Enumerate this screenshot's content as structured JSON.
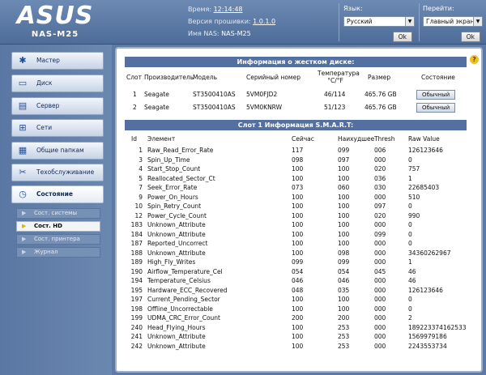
{
  "header": {
    "brand": "ASUS",
    "model": "NAS-M25",
    "time_label": "Время:",
    "time_value": "12:14:48",
    "firmware_label": "Версия прошивки:",
    "firmware_value": "1.0.1.0",
    "nas_name_label": "Имя NAS:",
    "nas_name_value": "NAS-M25",
    "language_label": "Язык:",
    "language_value": "Русский",
    "language_ok": "Ok",
    "goto_label": "Перейти:",
    "goto_value": "Главный экран",
    "goto_ok": "Ok"
  },
  "sidebar": {
    "items": [
      {
        "label": "Мастер",
        "icon": "wizard-icon"
      },
      {
        "label": "Диск",
        "icon": "disk-icon"
      },
      {
        "label": "Сервер",
        "icon": "server-icon"
      },
      {
        "label": "Сети",
        "icon": "network-icon"
      },
      {
        "label": "Общие папкам",
        "icon": "shared-folder-icon"
      },
      {
        "label": "Техобслуживание",
        "icon": "maintenance-icon"
      },
      {
        "label": "Состояние",
        "icon": "status-icon"
      }
    ],
    "subitems": [
      {
        "label": "Сост. системы"
      },
      {
        "label": "Сост. HD"
      },
      {
        "label": "Сост. принтера"
      },
      {
        "label": "Журнал"
      }
    ]
  },
  "disk_info": {
    "title": "Информация о жестком диске:",
    "columns": {
      "slot": "Слот",
      "vendor": "Производитель",
      "model": "Модель",
      "serial": "Серийный номер",
      "temp": "Температура °C/°F",
      "size": "Размер",
      "status": "Состояние"
    },
    "rows": [
      {
        "slot": "1",
        "vendor": "Seagate",
        "model": "ST3500410AS",
        "serial": "5VM0FJD2",
        "temp": "46/114",
        "size": "465.76 GB",
        "status": "Обычный"
      },
      {
        "slot": "2",
        "vendor": "Seagate",
        "model": "ST3500410AS",
        "serial": "5VM0KNRW",
        "temp": "51/123",
        "size": "465.76 GB",
        "status": "Обычный"
      }
    ]
  },
  "smart": {
    "title": "Слот 1 Информация S.M.A.R.T:",
    "columns": {
      "id": "Id",
      "element": "Элемент",
      "now": "Сейчас",
      "worst": "Наихудшее",
      "thresh": "Thresh",
      "raw": "Raw Value"
    },
    "rows": [
      {
        "id": "1",
        "element": "Raw_Read_Error_Rate",
        "now": "117",
        "worst": "099",
        "thresh": "006",
        "raw": "126123646"
      },
      {
        "id": "3",
        "element": "Spin_Up_Time",
        "now": "098",
        "worst": "097",
        "thresh": "000",
        "raw": "0"
      },
      {
        "id": "4",
        "element": "Start_Stop_Count",
        "now": "100",
        "worst": "100",
        "thresh": "020",
        "raw": "757"
      },
      {
        "id": "5",
        "element": "Reallocated_Sector_Ct",
        "now": "100",
        "worst": "100",
        "thresh": "036",
        "raw": "1"
      },
      {
        "id": "7",
        "element": "Seek_Error_Rate",
        "now": "073",
        "worst": "060",
        "thresh": "030",
        "raw": "22685403"
      },
      {
        "id": "9",
        "element": "Power_On_Hours",
        "now": "100",
        "worst": "100",
        "thresh": "000",
        "raw": "510"
      },
      {
        "id": "10",
        "element": "Spin_Retry_Count",
        "now": "100",
        "worst": "100",
        "thresh": "097",
        "raw": "0"
      },
      {
        "id": "12",
        "element": "Power_Cycle_Count",
        "now": "100",
        "worst": "100",
        "thresh": "020",
        "raw": "990"
      },
      {
        "id": "183",
        "element": "Unknown_Attribute",
        "now": "100",
        "worst": "100",
        "thresh": "000",
        "raw": "0"
      },
      {
        "id": "184",
        "element": "Unknown_Attribute",
        "now": "100",
        "worst": "100",
        "thresh": "099",
        "raw": "0"
      },
      {
        "id": "187",
        "element": "Reported_Uncorrect",
        "now": "100",
        "worst": "100",
        "thresh": "000",
        "raw": "0"
      },
      {
        "id": "188",
        "element": "Unknown_Attribute",
        "now": "100",
        "worst": "098",
        "thresh": "000",
        "raw": "34360262967"
      },
      {
        "id": "189",
        "element": "High_Fly_Writes",
        "now": "099",
        "worst": "099",
        "thresh": "000",
        "raw": "1"
      },
      {
        "id": "190",
        "element": "Airflow_Temperature_Cel",
        "now": "054",
        "worst": "054",
        "thresh": "045",
        "raw": "46"
      },
      {
        "id": "194",
        "element": "Temperature_Celsius",
        "now": "046",
        "worst": "046",
        "thresh": "000",
        "raw": "46"
      },
      {
        "id": "195",
        "element": "Hardware_ECC_Recovered",
        "now": "048",
        "worst": "035",
        "thresh": "000",
        "raw": "126123646"
      },
      {
        "id": "197",
        "element": "Current_Pending_Sector",
        "now": "100",
        "worst": "100",
        "thresh": "000",
        "raw": "0"
      },
      {
        "id": "198",
        "element": "Offline_Uncorrectable",
        "now": "100",
        "worst": "100",
        "thresh": "000",
        "raw": "0"
      },
      {
        "id": "199",
        "element": "UDMA_CRC_Error_Count",
        "now": "200",
        "worst": "200",
        "thresh": "000",
        "raw": "2"
      },
      {
        "id": "240",
        "element": "Head_Flying_Hours",
        "now": "100",
        "worst": "253",
        "thresh": "000",
        "raw": "189223374162533"
      },
      {
        "id": "241",
        "element": "Unknown_Attribute",
        "now": "100",
        "worst": "253",
        "thresh": "000",
        "raw": "1569979186"
      },
      {
        "id": "242",
        "element": "Unknown_Attribute",
        "now": "100",
        "worst": "253",
        "thresh": "000",
        "raw": "2243553734"
      }
    ]
  },
  "help_icon": "help-icon"
}
